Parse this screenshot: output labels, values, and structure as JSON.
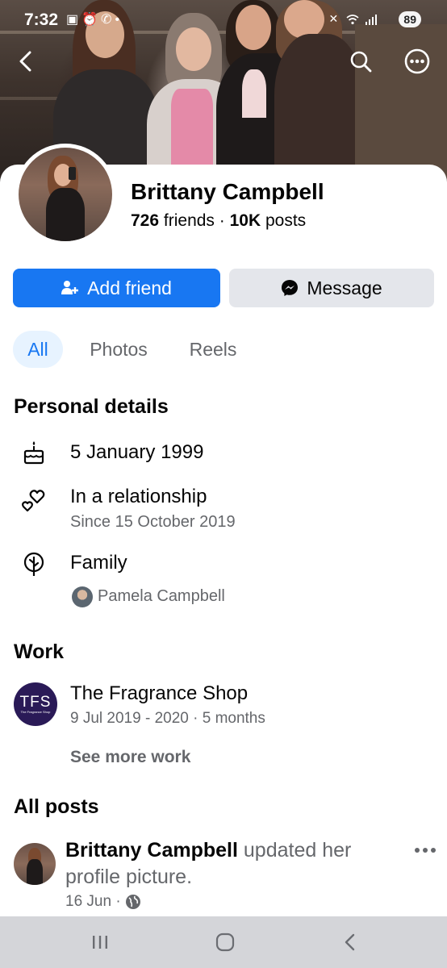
{
  "status_bar": {
    "time": "7:32",
    "left_icons": [
      "notification-icon",
      "alarm-icon",
      "call-icon",
      "dot-icon"
    ],
    "right_icons": [
      "mute-icon",
      "wifi-icon",
      "signal-icon"
    ],
    "battery": "89"
  },
  "top_bar": {
    "back_icon": "back-arrow-icon",
    "search_icon": "search-icon",
    "more_icon": "more-options-icon"
  },
  "profile": {
    "name": "Brittany Campbell",
    "friends_count": "726",
    "friends_label": "friends",
    "separator": "·",
    "posts_count": "10K",
    "posts_label": "posts"
  },
  "actions": {
    "add_friend": "Add friend",
    "message": "Message"
  },
  "tabs": [
    {
      "label": "All",
      "selected": true
    },
    {
      "label": "Photos",
      "selected": false
    },
    {
      "label": "Reels",
      "selected": false
    }
  ],
  "personal_details": {
    "title": "Personal details",
    "birthday": "5 January 1999",
    "relationship": "In a relationship",
    "relationship_since": "Since 15 October 2019",
    "family_label": "Family",
    "family_member": "Pamela Campbell"
  },
  "work": {
    "title": "Work",
    "logo_text": "TFS",
    "logo_subtext": "The Fragrance Shop",
    "employer": "The Fragrance Shop",
    "dates": "9 Jul 2019 - 2020 · 5 months",
    "see_more": "See more work"
  },
  "posts": {
    "title": "All posts",
    "items": [
      {
        "author": "Brittany Campbell",
        "action": "updated her profile picture.",
        "date": "16 Jun ·",
        "privacy_icon": "globe-icon"
      }
    ]
  },
  "colors": {
    "primary": "#1877f2",
    "secondary_button": "#e4e6eb",
    "tab_selected_bg": "#e7f3ff",
    "muted_text": "#65676b",
    "tfs_logo": "#2a1a57",
    "nav_bar": "#d4d5d9"
  },
  "nav_bar": {
    "recents_icon": "recent-apps-icon",
    "home_icon": "home-icon",
    "back_icon": "nav-back-icon"
  }
}
